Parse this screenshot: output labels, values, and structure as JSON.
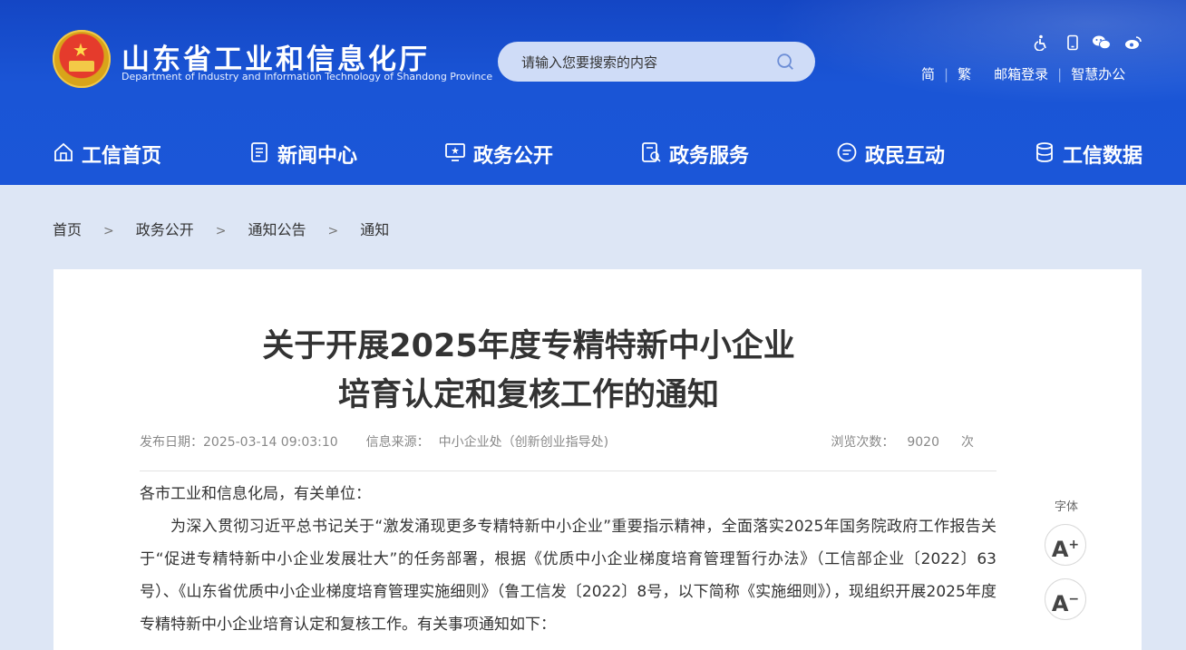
{
  "header": {
    "site_title": "山东省工业和信息化厅",
    "site_subtitle": "Department of Industry and Information Technology of Shandong Province",
    "search_placeholder": "请输入您要搜索的内容",
    "links": [
      "简",
      "繁",
      "邮箱登录",
      "智慧办公"
    ],
    "tool_icons": [
      "accessibility-icon",
      "mobile-icon",
      "wechat-icon",
      "weibo-icon"
    ]
  },
  "nav": {
    "items": [
      "工信首页",
      "新闻中心",
      "政务公开",
      "政务服务",
      "政民互动",
      "工信数据"
    ]
  },
  "breadcrumb": [
    "首页",
    "政务公开",
    "通知公告",
    "通知"
  ],
  "breadcrumb_separator": ">",
  "article": {
    "title_line1": "关于开展2025年度专精特新中小企业",
    "title_line2": "培育认定和复核工作的通知",
    "publish_date_label": "发布日期：",
    "publish_date": "2025-03-14 09:03:10",
    "source_label": "信息来源：",
    "source": "中小企业处（创新创业指导处)",
    "views_label": "浏览次数：",
    "views": "9020",
    "views_unit": "次",
    "salutation": "各市工业和信息化局，有关单位：",
    "paragraph1": "为深入贯彻习近平总书记关于“激发涌现更多专精特新中小企业”重要指示精神，全面落实2025年国务院政府工作报告关于“促进专精特新中小企业发展壮大”的任务部署，根据《优质中小企业梯度培育管理暂行办法》（工信部企业〔2022〕63号）、《山东省优质中小企业梯度培育管理实施细则》（鲁工信发〔2022〕8号，以下简称《实施细则》），现组织开展2025年度专精特新中小企业培育认定和复核工作。有关事项通知如下："
  },
  "font_tool": {
    "label": "字体",
    "increase": "A",
    "decrease": "A"
  },
  "colors": {
    "header_blue": "#1b56d8",
    "page_bg": "#dde6f5"
  }
}
